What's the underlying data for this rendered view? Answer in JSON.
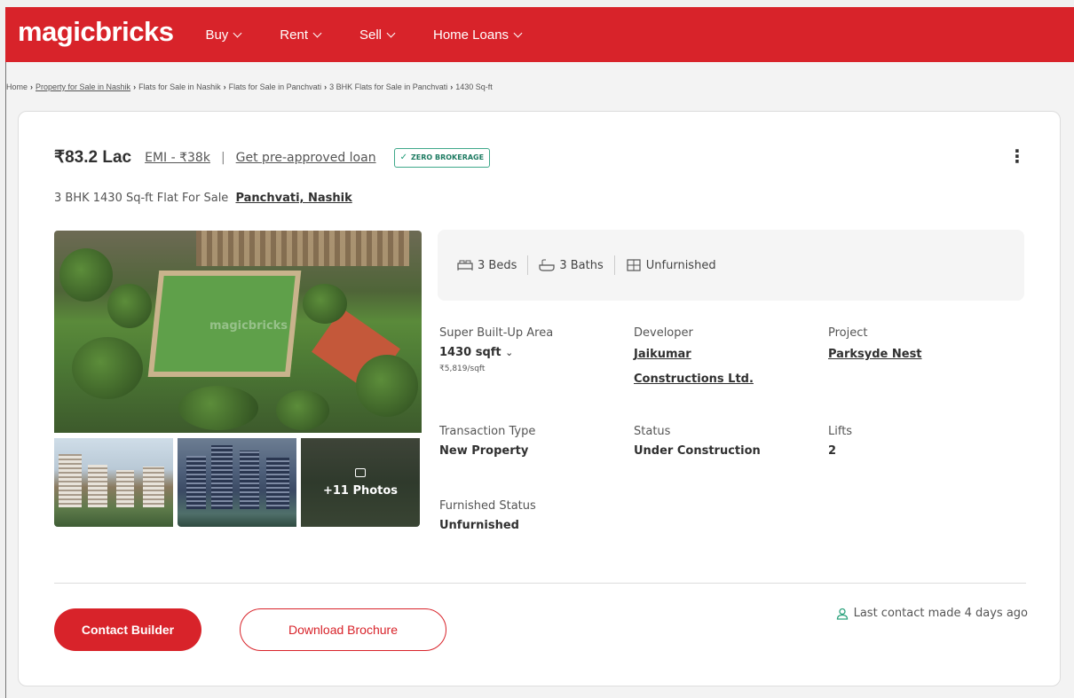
{
  "header": {
    "logo": "magicbricks",
    "nav": [
      "Buy",
      "Rent",
      "Sell",
      "Home Loans"
    ],
    "accent_color": "#d8232a"
  },
  "breadcrumb": [
    "Home",
    "Property for Sale in Nashik",
    "Flats for Sale in Nashik",
    "Flats for Sale in Panchvati",
    "3 BHK Flats for Sale in Panchvati",
    "1430 Sq-ft"
  ],
  "listing": {
    "price": "₹83.2 Lac",
    "emi": "EMI - ₹38k",
    "separator": "|",
    "loan_link": "Get pre-approved loan",
    "badge": "ZERO BROKERAGE",
    "subtitle": "3 BHK 1430 Sq-ft Flat For Sale",
    "location": "Panchvati, Nashik",
    "more_icon": "more-vertical-icon"
  },
  "gallery": {
    "watermark": "magicbricks",
    "more_photos": "+11 Photos"
  },
  "specs": {
    "beds": "3 Beds",
    "baths": "3 Baths",
    "furnishing": "Unfurnished"
  },
  "details": {
    "area_label": "Super Built-Up Area",
    "area_value": "1430 sqft",
    "area_rate": "₹5,819/sqft",
    "developer_label": "Developer",
    "developer_line1": "Jaikumar",
    "developer_line2": "Constructions Ltd.",
    "project_label": "Project",
    "project_value": "Parksyde Nest",
    "transaction_label": "Transaction Type",
    "transaction_value": "New Property",
    "status_label": "Status",
    "status_value": "Under Construction",
    "lifts_label": "Lifts",
    "lifts_value": "2",
    "furnished_label": "Furnished Status",
    "furnished_value": "Unfurnished"
  },
  "actions": {
    "contact": "Contact Builder",
    "brochure": "Download Brochure",
    "last_contact": "Last contact made 4 days ago"
  }
}
